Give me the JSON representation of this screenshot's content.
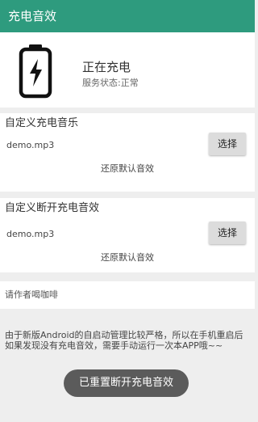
{
  "app": {
    "title": "充电音效"
  },
  "status": {
    "icon": "battery-charging-icon",
    "title": "正在充电",
    "subtitle": "服务状态:正常"
  },
  "charge_card": {
    "title": "自定义充电音乐",
    "file": "demo.mp3",
    "choose_label": "选择",
    "restore_label": "还原默认音效"
  },
  "disconnect_card": {
    "title": "自定义断开充电音效",
    "file": "demo.mp3",
    "choose_label": "选择",
    "restore_label": "还原默认音效"
  },
  "coffee": {
    "label": "请作者喝咖啡"
  },
  "notice": "由于新版Android的自启动管理比较严格，所以在手机重启后如果发现没有充电音效，需要手动运行一次本APP哦~~",
  "toast": "已重置断开充电音效",
  "colors": {
    "appbar": "#2e9b7e",
    "background": "#eeeeee"
  }
}
